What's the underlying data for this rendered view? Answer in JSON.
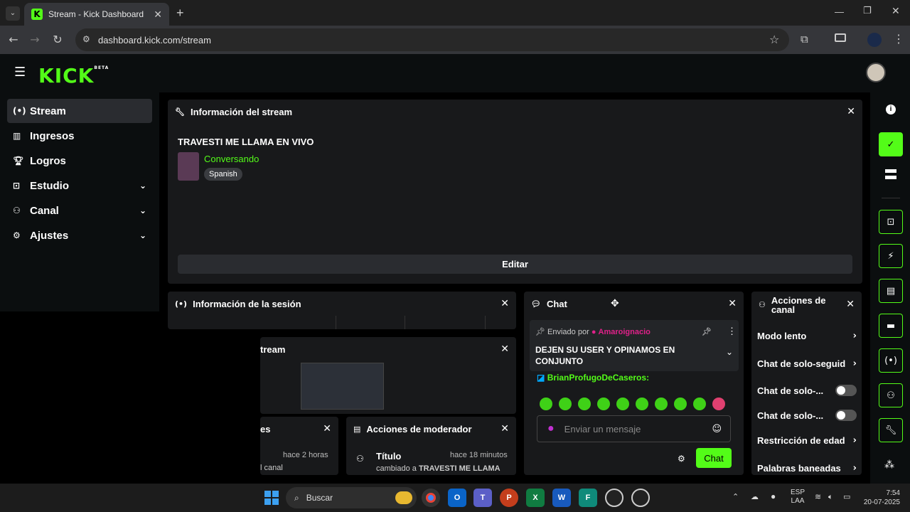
{
  "browser": {
    "tab_title": "Stream - Kick Dashboard",
    "url": "dashboard.kick.com/stream",
    "new_tab": "+"
  },
  "brand": {
    "logo": "KICK",
    "beta": "BETA",
    "accent": "#53fc18"
  },
  "sidebar": {
    "items": [
      {
        "label": "Stream",
        "icon": "broadcast-icon"
      },
      {
        "label": "Ingresos",
        "icon": "chart-icon"
      },
      {
        "label": "Logros",
        "icon": "trophy-icon"
      },
      {
        "label": "Estudio",
        "icon": "camera-icon"
      },
      {
        "label": "Canal",
        "icon": "channel-icon"
      },
      {
        "label": "Ajustes",
        "icon": "gear-icon"
      }
    ]
  },
  "stream_info": {
    "title": "Información del stream",
    "stream_title": "TRAVESTI ME LLAMA EN VIVO",
    "category": "Conversando",
    "language": "Spanish",
    "edit_label": "Editar"
  },
  "session_info": {
    "title": "Información de la sesión"
  },
  "stream_preview": {
    "title": "tream"
  },
  "partial_panel": {
    "title": "es",
    "time": "hace 2 horas",
    "text": "l canal"
  },
  "mod_actions": {
    "title": "Acciones de moderador",
    "item_title": "Título",
    "item_time": "hace 18 minutos",
    "item_text_prefix": "cambiado a ",
    "item_text_value": "TRAVESTI ME LLAMA"
  },
  "chat": {
    "title": "Chat",
    "pinned_by_label": "Enviado por",
    "pinned_by_user": "Amaroignacio",
    "pinned_message": "DEJEN SU USER Y OPINAMOS EN CONJUNTO",
    "message_user": "BrianProfugoDeCaseros",
    "input_placeholder": "Enviar un mensaje",
    "send_label": "Chat"
  },
  "channel_actions": {
    "title": "Acciones de canal",
    "items": [
      {
        "label": "Modo lento"
      },
      {
        "label": "Chat de solo-seguid"
      },
      {
        "label": "Chat de solo-..."
      },
      {
        "label": "Chat de solo-..."
      },
      {
        "label": "Restricción de edad"
      },
      {
        "label": "Palabras baneadas"
      }
    ]
  },
  "taskbar": {
    "search": "Buscar",
    "lang1": "ESP",
    "lang2": "LAA",
    "time": "7:54",
    "date": "20-07-2025"
  }
}
